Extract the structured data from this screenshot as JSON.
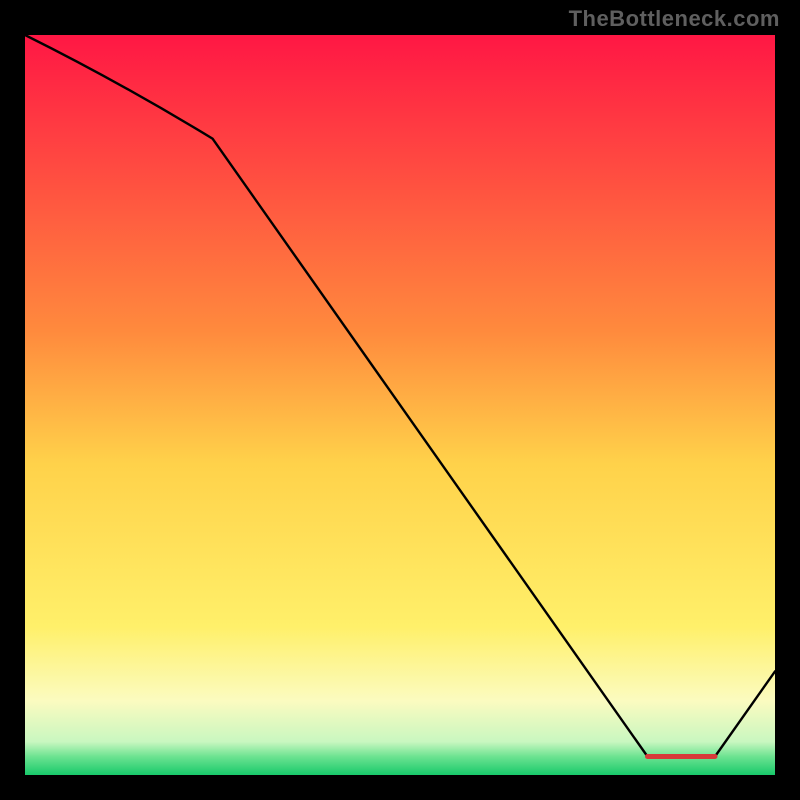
{
  "watermark": "TheBottleneck.com",
  "chart_data": {
    "type": "line",
    "title": "",
    "xlabel": "",
    "ylabel": "",
    "xlim": [
      0,
      100
    ],
    "ylim": [
      0,
      100
    ],
    "x": [
      0,
      25,
      83,
      92,
      100
    ],
    "values": [
      100,
      86,
      2.5,
      2.5,
      14
    ],
    "gradient_stops": [
      {
        "offset": 0.0,
        "color": "#ff1744"
      },
      {
        "offset": 0.4,
        "color": "#ff8a3d"
      },
      {
        "offset": 0.58,
        "color": "#ffd24a"
      },
      {
        "offset": 0.8,
        "color": "#fff06a"
      },
      {
        "offset": 0.9,
        "color": "#fbfbc0"
      },
      {
        "offset": 0.955,
        "color": "#c9f7c0"
      },
      {
        "offset": 0.975,
        "color": "#6de391"
      },
      {
        "offset": 1.0,
        "color": "#18c96b"
      }
    ],
    "flat_segment_color": "#d73a3a"
  }
}
